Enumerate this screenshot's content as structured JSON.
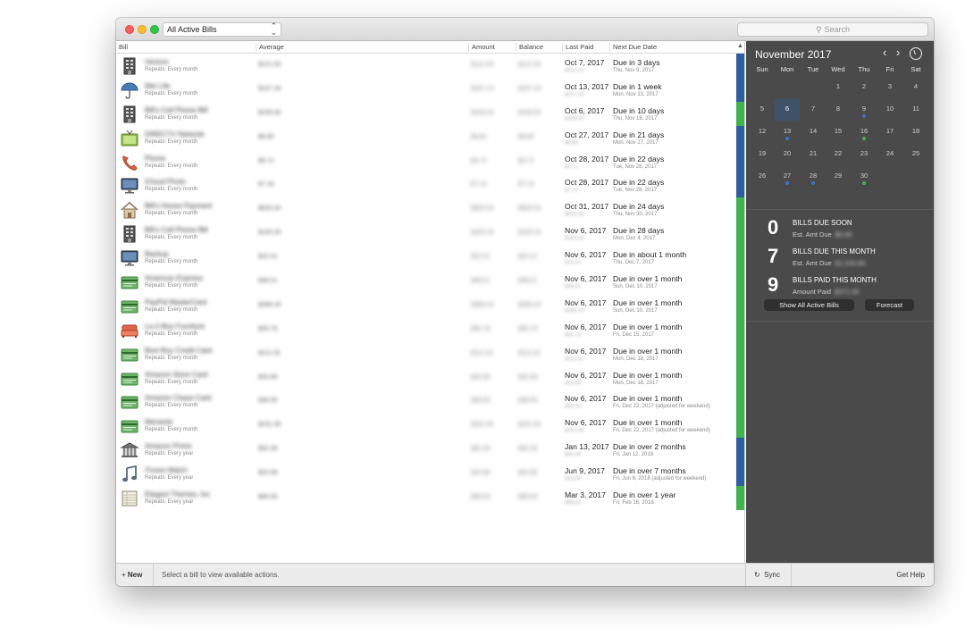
{
  "toolbar": {
    "filter": "All Active Bills",
    "search_placeholder": "Search"
  },
  "columns": {
    "bill": "Bill",
    "average": "Average",
    "amount": "Amount",
    "balance": "Balance",
    "last_paid": "Last Paid",
    "next_due": "Next Due Date"
  },
  "bills": [
    {
      "icon": "building-icon",
      "name": "Verizon",
      "repeats": "Repeats: Every month",
      "average": "$121.00",
      "amount": "$121.00",
      "balance": "$121.00",
      "last_paid": "Oct 7, 2017",
      "last_sub": "$121.00",
      "due": "Due in 3 days",
      "due_date": "Thu, Nov 9, 2017",
      "bar": "#2d5da3"
    },
    {
      "icon": "umbrella-icon",
      "name": "Met Life",
      "repeats": "Repeats: Every month",
      "average": "$107.19",
      "amount": "$107.19",
      "balance": "$107.19",
      "last_paid": "Oct 13, 2017",
      "last_sub": "$107.19",
      "due": "Due in 1 week",
      "due_date": "Mon, Nov 13, 2017",
      "bar": "#2d5da3"
    },
    {
      "icon": "building-icon",
      "name": "Bill's Cell Phone Bill",
      "repeats": "Repeats: Every month",
      "average": "$109.00",
      "amount": "$109.00",
      "balance": "$109.00",
      "last_paid": "Oct 6, 2017",
      "last_sub": "$109.00",
      "due": "Due in 10 days",
      "due_date": "Thu, Nov 16, 2017",
      "bar": "#3db54a"
    },
    {
      "icon": "tv-icon",
      "name": "DIRECTV Network",
      "repeats": "Repeats: Every month",
      "average": "$8.80",
      "amount": "$8.80",
      "balance": "$8.80",
      "last_paid": "Oct 27, 2017",
      "last_sub": "$8.80",
      "due": "Due in 21 days",
      "due_date": "Mon, Nov 27, 2017",
      "bar": "#2d5da3"
    },
    {
      "icon": "phone-icon",
      "name": "Phone",
      "repeats": "Repeats: Every month",
      "average": "$0.72",
      "amount": "$0.72",
      "balance": "$0.72",
      "last_paid": "Oct 28, 2017",
      "last_sub": "$0.72",
      "due": "Due in 22 days",
      "due_date": "Tue, Nov 28, 2017",
      "bar": "#2d5da3"
    },
    {
      "icon": "monitor-icon",
      "name": "iCloud Photo",
      "repeats": "Repeats: Every month",
      "average": "$7.10",
      "amount": "$7.10",
      "balance": "$7.10",
      "last_paid": "Oct 28, 2017",
      "last_sub": "$7.10",
      "due": "Due in 22 days",
      "due_date": "Tue, Nov 28, 2017",
      "bar": "#2d5da3"
    },
    {
      "icon": "house-icon",
      "name": "Bill's House Payment",
      "repeats": "Repeats: Every month",
      "average": "$833.33",
      "amount": "$833.33",
      "balance": "$833.33",
      "last_paid": "Oct 31, 2017",
      "last_sub": "$833.33",
      "due": "Due in 24 days",
      "due_date": "Thu, Nov 30, 2017",
      "bar": "#3db54a"
    },
    {
      "icon": "building-icon",
      "name": "Bill's Cell Phone Bill",
      "repeats": "Repeats: Every month",
      "average": "$105.29",
      "amount": "$105.29",
      "balance": "$105.29",
      "last_paid": "Nov 6, 2017",
      "last_sub": "$105.29",
      "due": "Due in 28 days",
      "due_date": "Mon, Dec 4, 2017",
      "bar": "#3db54a"
    },
    {
      "icon": "monitor-icon",
      "name": "Backup",
      "repeats": "Repeats: Every month",
      "average": "$22.22",
      "amount": "$22.22",
      "balance": "$22.22",
      "last_paid": "Nov 6, 2017",
      "last_sub": "$22.22",
      "due": "Due in about 1 month",
      "due_date": "Thu, Dec 7, 2017",
      "bar": "#3db54a"
    },
    {
      "icon": "card-icon",
      "name": "American Express",
      "repeats": "Repeats: Every month",
      "average": "$38.01",
      "amount": "$38.01",
      "balance": "$38.01",
      "last_paid": "Nov 6, 2017",
      "last_sub": "$38.01",
      "due": "Due in over 1 month",
      "due_date": "Sun, Dec 10, 2017",
      "bar": "#3db54a"
    },
    {
      "icon": "card-icon",
      "name": "PayPal MasterCard",
      "repeats": "Repeats: Every month",
      "average": "$308.16",
      "amount": "$308.16",
      "balance": "$308.16",
      "last_paid": "Nov 6, 2017",
      "last_sub": "$308.16",
      "due": "Due in over 1 month",
      "due_date": "Sun, Dec 10, 2017",
      "bar": "#3db54a"
    },
    {
      "icon": "couch-icon",
      "name": "La-Z-Boy Furniture",
      "repeats": "Repeats: Every month",
      "average": "$55.78",
      "amount": "$55.78",
      "balance": "$55.78",
      "last_paid": "Nov 6, 2017",
      "last_sub": "$55.78",
      "due": "Due in over 1 month",
      "due_date": "Fri, Dec 15, 2017",
      "bar": "#3db54a"
    },
    {
      "icon": "card-icon",
      "name": "Best Buy Credit Card",
      "repeats": "Repeats: Every month",
      "average": "$112.32",
      "amount": "$112.32",
      "balance": "$112.32",
      "last_paid": "Nov 6, 2017",
      "last_sub": "$112.32",
      "due": "Due in over 1 month",
      "due_date": "Mon, Dec 18, 2017",
      "bar": "#3db54a"
    },
    {
      "icon": "card-icon",
      "name": "Amazon Store Card",
      "repeats": "Repeats: Every month",
      "average": "$32.89",
      "amount": "$32.89",
      "balance": "$32.89",
      "last_paid": "Nov 6, 2017",
      "last_sub": "$32.89",
      "due": "Due in over 1 month",
      "due_date": "Mon, Dec 18, 2017",
      "bar": "#3db54a"
    },
    {
      "icon": "card-icon",
      "name": "Amazon Chase Card",
      "repeats": "Repeats: Every month",
      "average": "$38.55",
      "amount": "$38.55",
      "balance": "$38.55",
      "last_paid": "Nov 6, 2017",
      "last_sub": "$38.55",
      "due": "Due in over 1 month",
      "due_date": "Fri, Dec 22, 2017 (adjusted for weekend)",
      "bar": "#3db54a"
    },
    {
      "icon": "card-icon",
      "name": "Menards",
      "repeats": "Repeats: Every month",
      "average": "$231.95",
      "amount": "$231.95",
      "balance": "$231.95",
      "last_paid": "Nov 6, 2017",
      "last_sub": "$231.95",
      "due": "Due in over 1 month",
      "due_date": "Fri, Dec 22, 2017 (adjusted for weekend)",
      "bar": "#3db54a"
    },
    {
      "icon": "bank-icon",
      "name": "Amazon Prime",
      "repeats": "Repeats: Every year",
      "average": "$92.39",
      "amount": "$92.39",
      "balance": "$92.39",
      "last_paid": "Jan 13, 2017",
      "last_sub": "$92.39",
      "due": "Due in over 2 months",
      "due_date": "Fri, Jan 12, 2018",
      "bar": "#2d5da3"
    },
    {
      "icon": "music-icon",
      "name": "iTunes Match",
      "repeats": "Repeats: Every year",
      "average": "$24.99",
      "amount": "$24.99",
      "balance": "$24.99",
      "last_paid": "Jun 9, 2017",
      "last_sub": "$24.99",
      "due": "Due in over 7 months",
      "due_date": "Fri, Jun 8, 2018 (adjusted for weekend)",
      "bar": "#2d5da3"
    },
    {
      "icon": "ledger-icon",
      "name": "Elegant Themes, Inc",
      "repeats": "Repeats: Every year",
      "average": "$69.00",
      "amount": "$69.00",
      "balance": "$69.00",
      "last_paid": "Mar 3, 2017",
      "last_sub": "$69.00",
      "due": "Due in over 1 year",
      "due_date": "Fri, Feb 16, 2018",
      "bar": "#3db54a"
    }
  ],
  "footer": {
    "new_label": "New",
    "hint": "Select a bill to view available actions.",
    "sync_label": "Sync",
    "help_label": "Get Help"
  },
  "calendar": {
    "month": "November 2017",
    "weekdays": [
      "Sun",
      "Mon",
      "Tue",
      "Wed",
      "Thu",
      "Fri",
      "Sat"
    ],
    "weeks": [
      [
        "",
        "",
        "",
        "1",
        "2",
        "3",
        "4"
      ],
      [
        "5",
        "6",
        "7",
        "8",
        "9",
        "10",
        "11"
      ],
      [
        "12",
        "13",
        "14",
        "15",
        "16",
        "17",
        "18"
      ],
      [
        "19",
        "20",
        "21",
        "22",
        "23",
        "24",
        "25"
      ],
      [
        "26",
        "27",
        "28",
        "29",
        "30",
        "",
        ""
      ]
    ],
    "selected": "6",
    "dots": {
      "9": "#3b73c7",
      "13": "#3b73c7",
      "16": "#3db54a",
      "27": "#3b73c7",
      "28": "#3b73c7",
      "30": "#3db54a"
    }
  },
  "summary": [
    {
      "count": "0",
      "label": "BILLS DUE SOON",
      "sub": "Est. Amt Due",
      "value": "$0.00"
    },
    {
      "count": "7",
      "label": "BILLS DUE THIS MONTH",
      "sub": "Est. Amt Due",
      "value": "$1,233.08"
    },
    {
      "count": "9",
      "label": "BILLS PAID THIS MONTH",
      "sub": "Amount Paid",
      "value": "$371.09"
    }
  ],
  "side_buttons": {
    "show_all": "Show All Active Bills",
    "forecast": "Forecast"
  }
}
